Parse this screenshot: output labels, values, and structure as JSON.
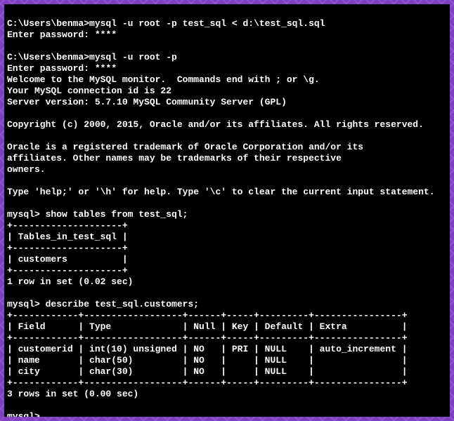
{
  "prompt1": "C:\\Users\\benma>",
  "cmd1": "mysql -u root -p test_sql < d:\\test_sql.sql",
  "pwline1": "Enter password: ****",
  "blank": "",
  "prompt2": "C:\\Users\\benma>",
  "cmd2": "mysql -u root -p",
  "pwline2": "Enter password: ****",
  "welcome": "Welcome to the MySQL monitor.  Commands end with ; or \\g.",
  "connid": "Your MySQL connection id is 22",
  "serverver": "Server version: 5.7.10 MySQL Community Server (GPL)",
  "copyright": "Copyright (c) 2000, 2015, Oracle and/or its affiliates. All rights reserved.",
  "trademark1": "Oracle is a registered trademark of Oracle Corporation and/or its",
  "trademark2": "affiliates. Other names may be trademarks of their respective",
  "trademark3": "owners.",
  "help": "Type 'help;' or '\\h' for help. Type '\\c' to clear the current input statement.",
  "mysqlprompt": "mysql> ",
  "cmd3": "show tables from test_sql;",
  "t1border": "+--------------------+",
  "t1header": "| Tables_in_test_sql |",
  "t1row1": "| customers          |",
  "t1result": "1 row in set (0.02 sec)",
  "cmd4": "describe test_sql.customers;",
  "t2border": "+------------+------------------+------+-----+---------+----------------+",
  "t2header": "| Field      | Type             | Null | Key | Default | Extra          |",
  "t2row1": "| customerid | int(10) unsigned | NO   | PRI | NULL    | auto_increment |",
  "t2row2": "| name       | char(50)         | NO   |     | NULL    |                |",
  "t2row3": "| city       | char(30)         | NO   |     | NULL    |                |",
  "t2result": "3 rows in set (0.00 sec)",
  "finalprompt": "mysql>"
}
